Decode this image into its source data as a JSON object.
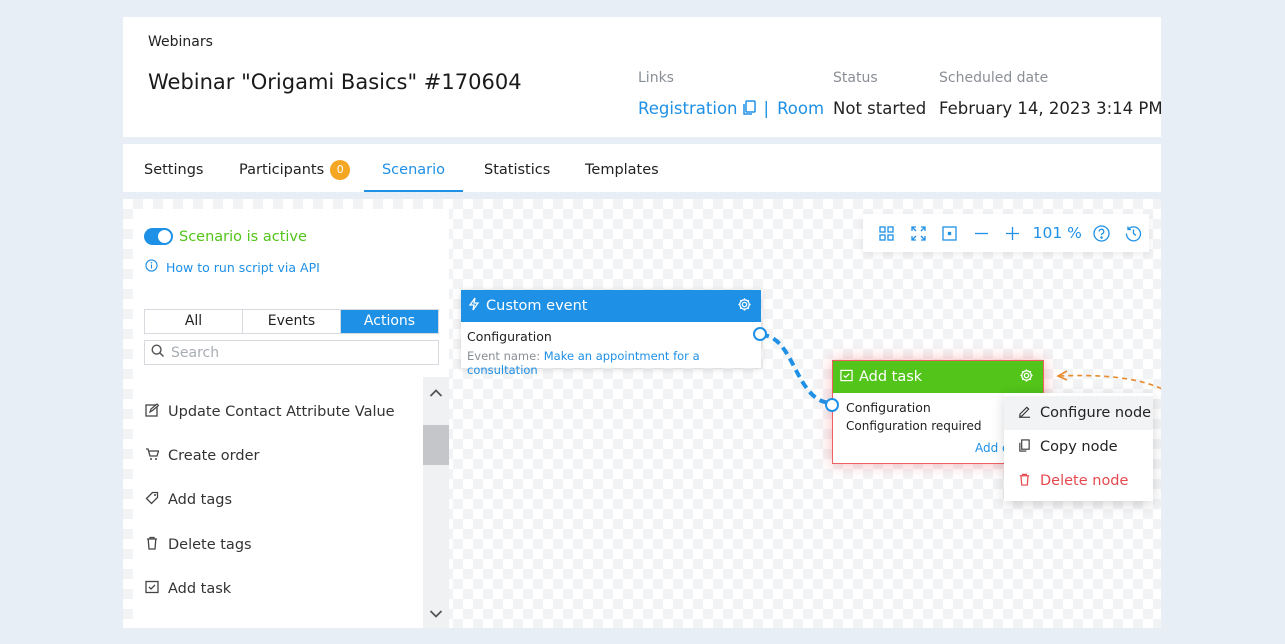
{
  "header": {
    "breadcrumb": "Webinars",
    "title": "Webinar \"Origami Basics\" #170604",
    "links_label": "Links",
    "registration_link": "Registration",
    "link_separator": "|",
    "room_link": "Room",
    "status_label": "Status",
    "status_value": "Not started",
    "date_label": "Scheduled date",
    "date_value": "February 14, 2023 3:14 PM"
  },
  "tabs": [
    {
      "label": "Settings"
    },
    {
      "label": "Participants",
      "badge": "0"
    },
    {
      "label": "Scenario",
      "active": true
    },
    {
      "label": "Statistics"
    },
    {
      "label": "Templates"
    }
  ],
  "sidebar": {
    "toggle_on": true,
    "active_label": "Scenario is active",
    "api_link": "How to run script via API",
    "filters": [
      "All",
      "Events",
      "Actions"
    ],
    "active_filter": "Actions",
    "search_placeholder": "Search",
    "items": [
      {
        "label": "Update Contact Attribute Value",
        "icon": "edit-icon"
      },
      {
        "label": "Create order",
        "icon": "cart-icon"
      },
      {
        "label": "Add tags",
        "icon": "tag-icon"
      },
      {
        "label": "Delete tags",
        "icon": "trash-icon"
      },
      {
        "label": "Add task",
        "icon": "checkbox-icon"
      }
    ]
  },
  "toolbar": {
    "zoom": "101 %",
    "buttons": [
      "grid-icon",
      "fit-screen-icon",
      "selection-icon",
      "zoom-out-icon",
      "zoom-in-icon",
      "help-icon",
      "history-icon"
    ]
  },
  "nodes": {
    "custom_event": {
      "title": "Custom event",
      "color": "#1e90e6",
      "body_title": "Configuration",
      "field_label": "Event name:",
      "field_value": "Make an appointment for a consultation"
    },
    "add_task": {
      "title": "Add task",
      "color": "#52c41a",
      "body_title": "Configuration",
      "body_sub": "Configuration required",
      "partial_link": "Add e"
    }
  },
  "context_menu": {
    "items": [
      {
        "label": "Configure node",
        "icon": "pencil-icon"
      },
      {
        "label": "Copy node",
        "icon": "copy-icon"
      },
      {
        "label": "Delete node",
        "icon": "trash-icon"
      }
    ]
  },
  "colors": {
    "accent": "#1e90e6",
    "success": "#52c41a",
    "danger": "#e5484d",
    "badge": "#f5a623",
    "annotation": "#e88b2e"
  }
}
